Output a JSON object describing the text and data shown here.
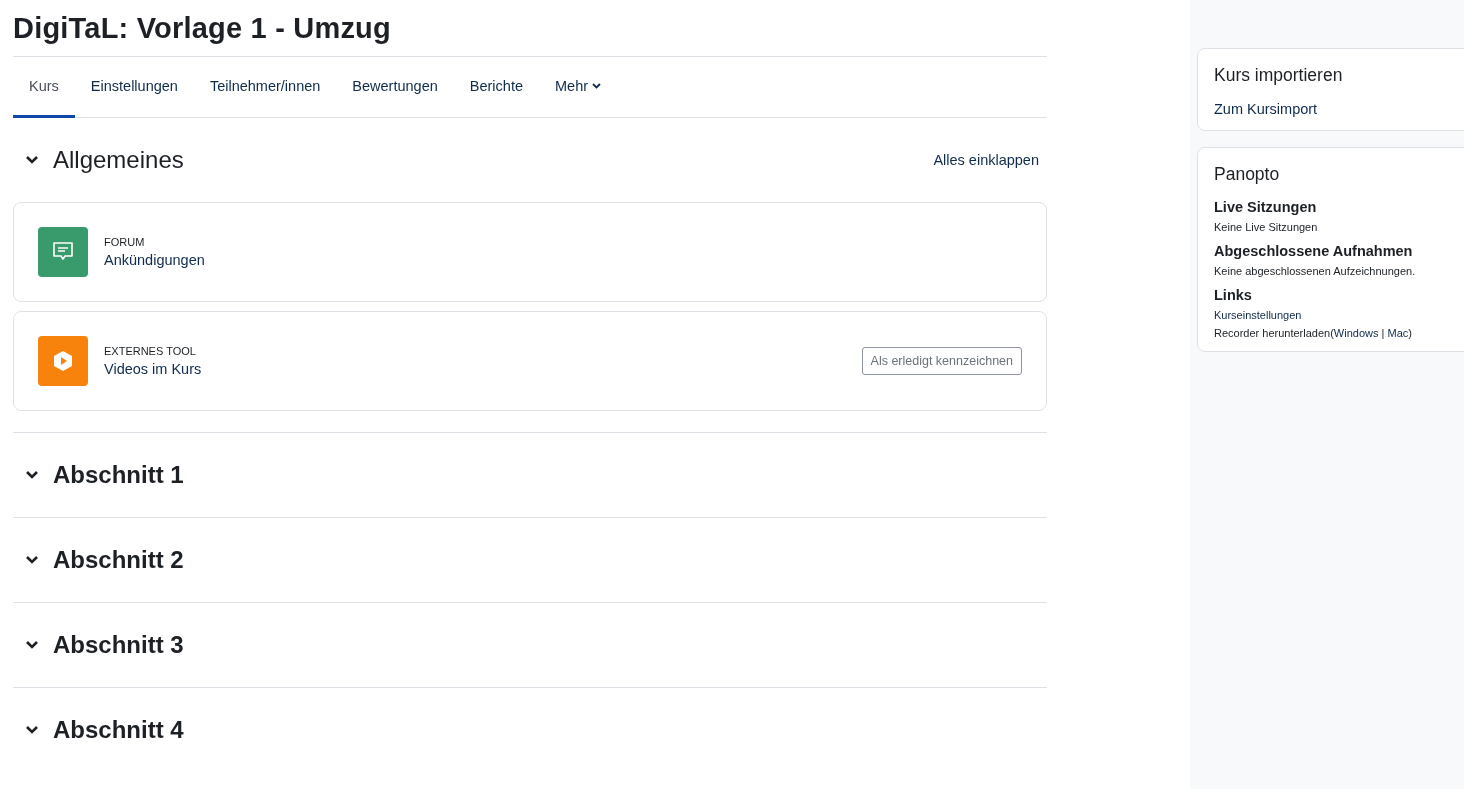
{
  "page_title": "DigiTaL: Vorlage 1 - Umzug",
  "tabs": [
    {
      "label": "Kurs",
      "selected": true
    },
    {
      "label": "Einstellungen",
      "selected": false
    },
    {
      "label": "Teilnehmer/innen",
      "selected": false
    },
    {
      "label": "Bewertungen",
      "selected": false
    },
    {
      "label": "Berichte",
      "selected": false
    },
    {
      "label": "Mehr",
      "selected": false,
      "dropdown": true
    }
  ],
  "collapse_all": "Alles einklappen",
  "sections": [
    {
      "title": "Allgemeines",
      "activities": [
        {
          "kind": "forum",
          "type_label": "FORUM",
          "name": "Ankündigungen"
        },
        {
          "kind": "video",
          "type_label": "EXTERNES TOOL",
          "name": "Videos im Kurs",
          "completion_button": "Als erledigt kennzeichnen"
        }
      ]
    },
    {
      "title": "Abschnitt 1"
    },
    {
      "title": "Abschnitt 2"
    },
    {
      "title": "Abschnitt 3"
    },
    {
      "title": "Abschnitt 4"
    }
  ],
  "blocks": {
    "import": {
      "title": "Kurs importieren",
      "link": "Zum Kursimport"
    },
    "panopto": {
      "title": "Panopto",
      "live_heading": "Live Sitzungen",
      "live_text": "Keine Live Sitzungen",
      "recorded_heading": "Abgeschlossene Aufnahmen",
      "recorded_text": "Keine abgeschlossenen Aufzeichnungen.",
      "links_heading": "Links",
      "settings_link": "Kurseinstellungen",
      "recorder_text": "Recorder herunterladen(",
      "windows_link": "Windows",
      "separator": "|",
      "mac_link": "Mac",
      "recorder_close": ")"
    }
  }
}
